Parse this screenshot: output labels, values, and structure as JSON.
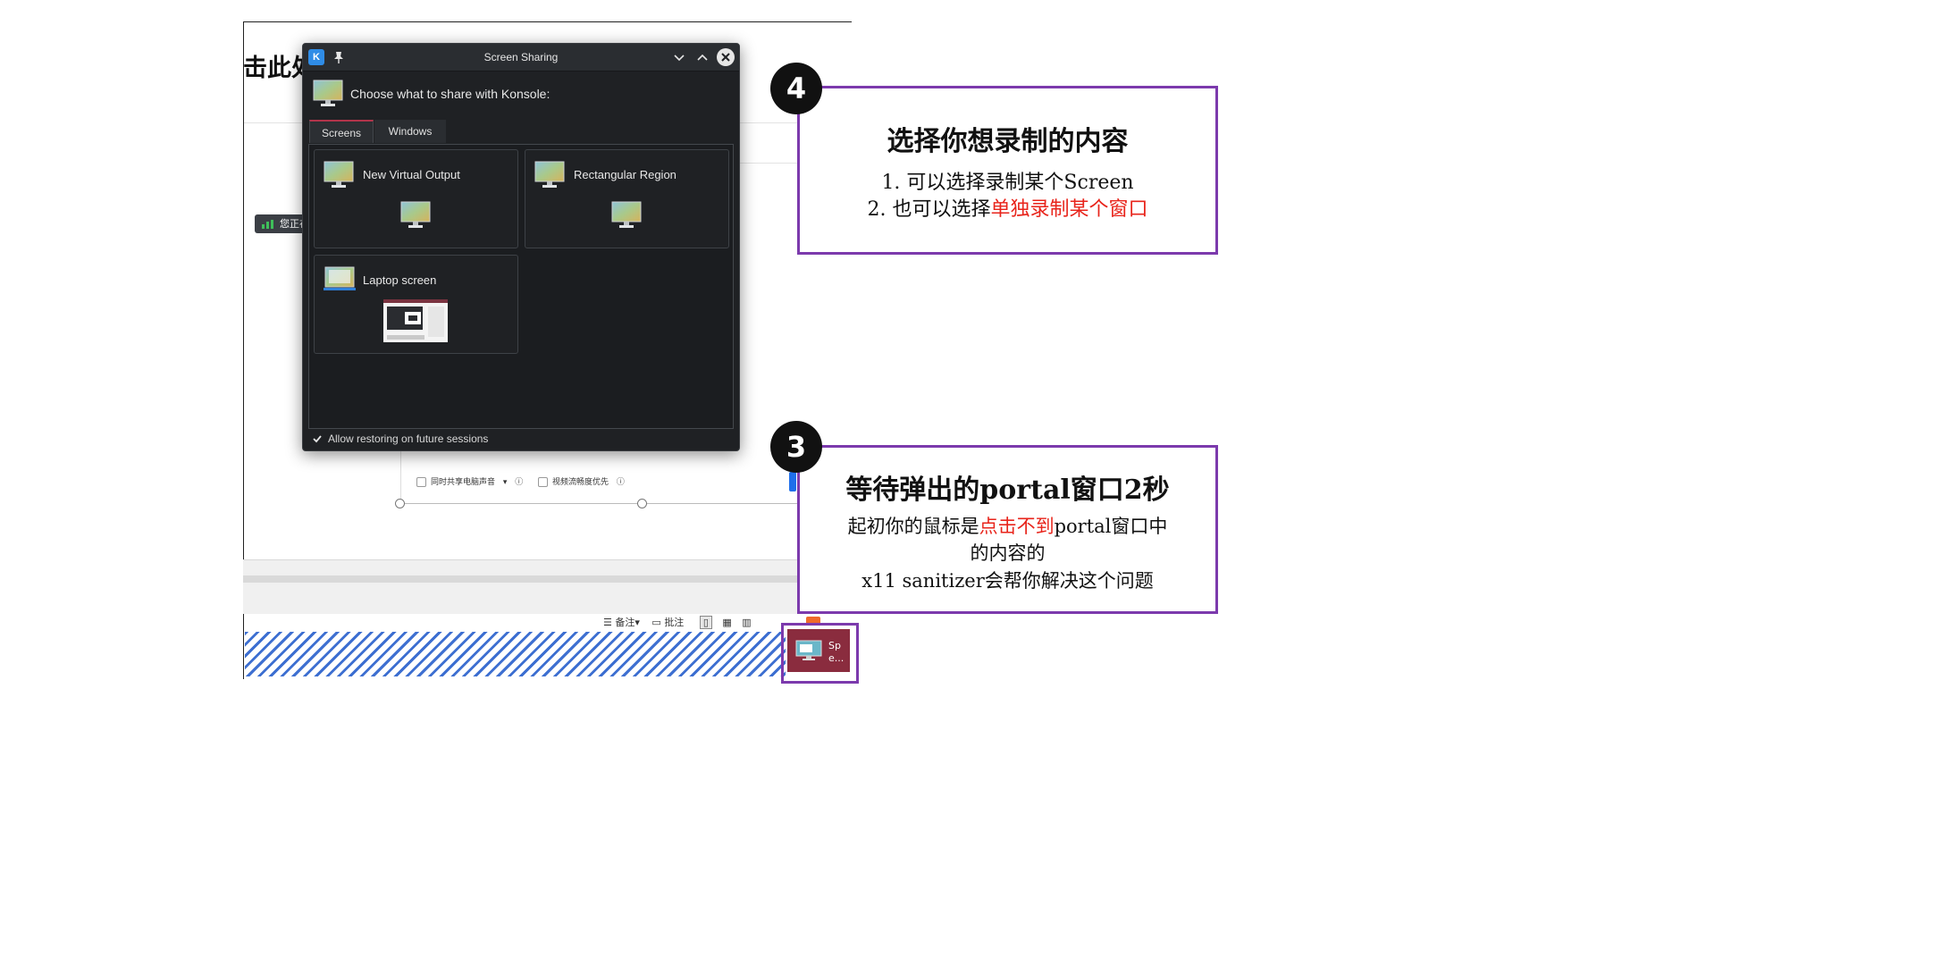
{
  "background": {
    "heading_fragment": "击此处",
    "sharing_badge": "您正在共享屏幕",
    "checkbox_audio": "同时共享电脑声音",
    "checkbox_video": "视频流畅度优先",
    "toolbar_notes": "备注",
    "toolbar_comment": "批注"
  },
  "dialog": {
    "title": "Screen Sharing",
    "app_icon_letter": "K",
    "prompt": "Choose what to share with Konsole:",
    "tabs": [
      {
        "label": "Screens",
        "selected": true
      },
      {
        "label": "Windows",
        "selected": false
      }
    ],
    "sources": [
      {
        "label": "New Virtual Output",
        "icon": "monitor-icon"
      },
      {
        "label": "Rectangular Region",
        "icon": "monitor-icon"
      },
      {
        "label": "Laptop screen",
        "icon": "laptop-screen-icon"
      }
    ],
    "allow_restore": {
      "label": "Allow restoring on future sessions",
      "checked": true
    }
  },
  "taskbar": {
    "item_label": "Spe..."
  },
  "annotations": {
    "step4": {
      "number": "4",
      "heading": "选择你想录制的内容",
      "line1": "1. 可以选择录制某个Screen",
      "line2_prefix": "2. 也可以选择",
      "line2_highlight": "单独录制某个窗口"
    },
    "step3": {
      "number": "3",
      "heading": "等待弹出的portal窗口2秒",
      "line1_prefix": "起初你的鼠标是",
      "line1_highlight": "点击不到",
      "line1_suffix": "portal窗口中",
      "line2": "的内容的",
      "line3": "x11 sanitizer会帮你解决这个问题"
    },
    "colors": {
      "border": "#7c3aad",
      "highlight": "#e8241b"
    }
  }
}
